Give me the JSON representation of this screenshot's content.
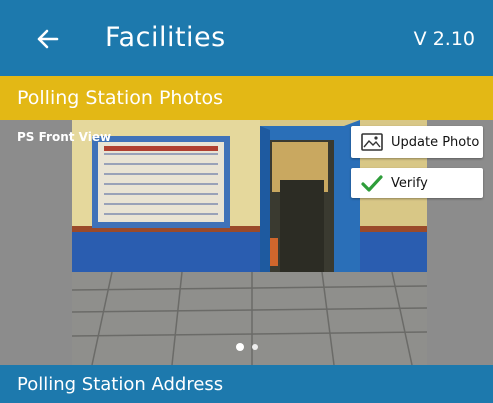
{
  "header": {
    "title": "Facilities",
    "version": "V 2.10",
    "back_icon": "arrow-left-icon",
    "background": "#1d79ad"
  },
  "photos_section": {
    "title": "Polling Station Photos",
    "background": "#e3b815"
  },
  "photo_viewer": {
    "label": "PS Front View",
    "update_photo_label": "Update Photo",
    "update_photo_icon": "image-icon",
    "verify_label": "Verify",
    "verify_icon": "checkmark-icon",
    "verify_icon_color": "#2e9d3a",
    "page_count": 2,
    "current_page": 1
  },
  "address_section": {
    "title": "Polling Station Address"
  }
}
